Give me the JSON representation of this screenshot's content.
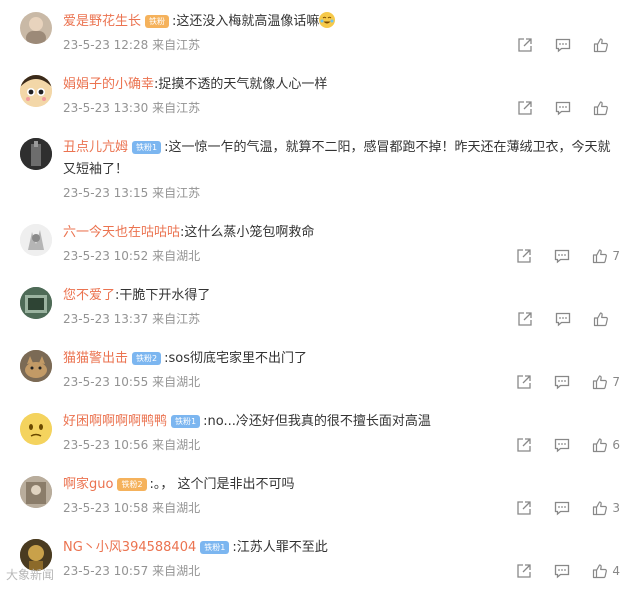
{
  "comments": [
    {
      "user": "爱是野花生长",
      "badge": "铁粉",
      "badge_color": "gold",
      "text": ":这还没入梅就高温像话嘛",
      "emoji": "laugh-cry",
      "time": "23-5-23 12:28",
      "location": "来自江苏",
      "likes": ""
    },
    {
      "user": "娟娟子的小确幸",
      "badge": "",
      "badge_color": "",
      "text": ":捉摸不透的天气就像人心一样",
      "emoji": "",
      "time": "23-5-23 13:30",
      "location": "来自江苏",
      "likes": ""
    },
    {
      "user": "丑点儿亢姆",
      "badge": "铁粉1",
      "badge_color": "blue",
      "text": ":这一惊一乍的气温，就算不二阳，感冒都跑不掉！昨天还在薄绒卫衣，今天就又短袖了！",
      "emoji": "",
      "time": "23-5-23 13:15",
      "location": "来自江苏",
      "likes": ""
    },
    {
      "user": "六一今天也在咕咕咕",
      "badge": "",
      "badge_color": "",
      "text": ":这什么蒸小笼包啊救命",
      "emoji": "",
      "time": "23-5-23 10:52",
      "location": "来自湖北",
      "likes": "7"
    },
    {
      "user": "您不爱了",
      "badge": "",
      "badge_color": "",
      "text": ":干脆下开水得了",
      "emoji": "",
      "time": "23-5-23 13:37",
      "location": "来自江苏",
      "likes": ""
    },
    {
      "user": "猫猫警出击",
      "badge": "铁粉2",
      "badge_color": "blue",
      "text": ":sos彻底宅家里不出门了",
      "emoji": "",
      "time": "23-5-23 10:55",
      "location": "来自湖北",
      "likes": "7"
    },
    {
      "user": "好困啊啊啊啊鸭鸭",
      "badge": "铁粉1",
      "badge_color": "blue",
      "text": ":no...冷还好但我真的很不擅长面对高温",
      "emoji": "",
      "time": "23-5-23 10:56",
      "location": "来自湖北",
      "likes": "6"
    },
    {
      "user": "啊家guo",
      "badge": "铁粉2",
      "badge_color": "gold",
      "text": ":。，  这个门是非出不可吗",
      "emoji": "",
      "time": "23-5-23 10:58",
      "location": "来自湖北",
      "likes": "3"
    },
    {
      "user": "NG丶小风394588404",
      "badge": "铁粉1",
      "badge_color": "blue",
      "text": ":江苏人罪不至此",
      "emoji": "",
      "time": "23-5-23 10:57",
      "location": "来自湖北",
      "likes": "4"
    }
  ],
  "watermark": "大象新闻",
  "colors": {
    "username": "#eb7350",
    "meta": "#939393",
    "icon": "#888888",
    "badge_gold": "#f5b25c",
    "badge_blue": "#7cb6f0"
  },
  "icons": {
    "share": "share-icon",
    "comment": "comment-icon",
    "like": "thumbs-up-icon"
  }
}
